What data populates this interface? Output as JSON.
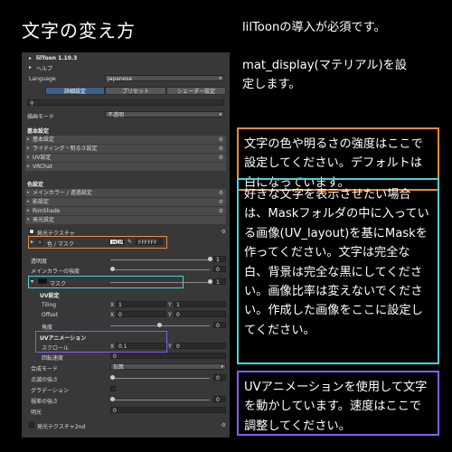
{
  "page": {
    "title": "文字の変え方"
  },
  "notes": {
    "line1": "lilToonの導入が必須です。",
    "line2a": "mat_display(マテリアル)を設",
    "line2b": "定します。"
  },
  "boxes": {
    "orange": {
      "color": "#f08a3c",
      "text": "文字の色や明るさの強度はここで設定してください。デフォルトは白になっています。"
    },
    "cyan": {
      "color": "#4fd1d9",
      "text": "好きな文字を表示させたい場合は、Maskフォルダの中に入っている画像(UV_layout)を基にMaskを作ってください。文字は完全な白、背景は完全な黒にしてください。画像比率は変えないでください。作成した画像をここに設定してください。"
    },
    "purple": {
      "color": "#8a5cf5",
      "text": "UVアニメーションを使用して文字を動かしています。速度はここで調整してください。"
    }
  },
  "inspector": {
    "version": "lilToon 1.10.3",
    "help": "ヘルプ",
    "language_label": "Language",
    "language_value": "Japanese",
    "tabs": [
      "詳細設定",
      "プリセット",
      "シェーダー設定"
    ],
    "search_icon": "search-icon",
    "render_mode_label": "描画モード",
    "render_mode_value": "不透明",
    "basic_header": "基本設定",
    "basic_items": [
      "基本設定",
      "ライティング・明るさ設定",
      "UV設定",
      "VRChat"
    ],
    "color_header": "色設定",
    "color_items": [
      "メインカラー / 透過設定",
      "影設定",
      "RimShade",
      "発光設定"
    ],
    "emission_tex_label": "発光テクスチャ",
    "color_mask_label": "色 / マスク",
    "hdr_label": "HDR",
    "color_hex": "FFFFFF",
    "opacity_label": "透明度",
    "opacity_value": "1",
    "maincolor_strength_label": "メインカラーの強度",
    "maincolor_strength_value": "0",
    "mask_label": "マスク",
    "mask_value": "1",
    "uv_header": "UV設定",
    "tiling_label": "Tiling",
    "tiling_x": "1",
    "tiling_y": "1",
    "offset_label": "Offset",
    "offset_x": "0",
    "offset_y": "0",
    "angle_label": "角度",
    "angle_value": "0",
    "uvanim_header": "UVアニメーション",
    "scroll_label": "スクロール",
    "scroll_x": "0.1",
    "scroll_y": "0",
    "rotation_label": "回転速度",
    "rotation_value": "0",
    "blend_label": "合成モード",
    "blend_value": "加算",
    "blink_strength_label": "点滅の強さ",
    "blink_strength_value": "0",
    "gradation_label": "グラデーション",
    "parallax_label": "視差の強さ",
    "parallax_value": "0",
    "glow_label": "明光",
    "glow_value": "0",
    "emission2_label": "発光テクスチャ2nd",
    "x": "X",
    "y": "Y"
  }
}
